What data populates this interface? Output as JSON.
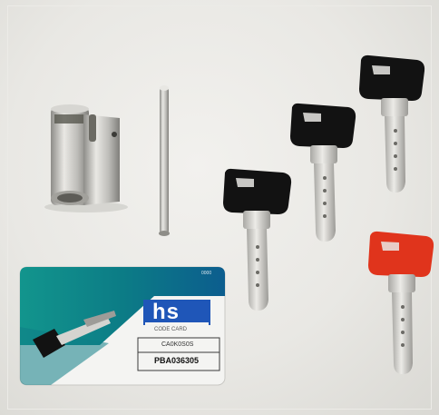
{
  "key_card": {
    "brand_logo": "hs",
    "card_title": "CODE CARD",
    "card_code": "CA0K0S0S",
    "card_number": "PBA036305",
    "corner_text": "0000"
  },
  "colors": {
    "background": "#e9e8e4",
    "key_head_black": "#121212",
    "key_head_red": "#e0341c",
    "card_teal": "#0f8f8a",
    "card_blue": "#1f56b8",
    "metal": "#c9c8c4"
  }
}
